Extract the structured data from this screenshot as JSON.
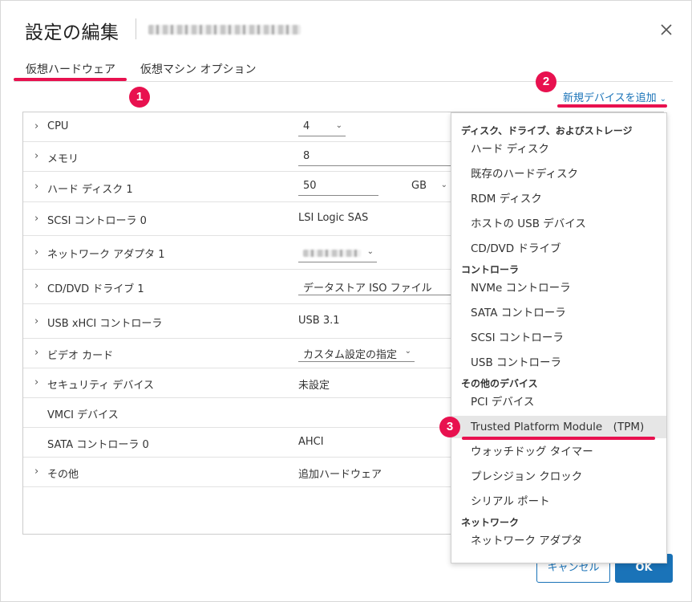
{
  "dialog": {
    "title": "設定の編集",
    "close_icon": "close-icon"
  },
  "tabs": [
    {
      "label": "仮想ハードウェア"
    },
    {
      "label": "仮想マシン オプション"
    }
  ],
  "markers": [
    "1",
    "2",
    "3"
  ],
  "add_device": {
    "label": "新規デバイスを追加",
    "icon": "chevron-down-icon"
  },
  "hardware": {
    "cpu": {
      "label": "CPU",
      "value": "4"
    },
    "memory": {
      "label": "メモリ",
      "value": "8"
    },
    "disk": {
      "label": "ハード ディスク 1",
      "value": "50",
      "unit": "GB"
    },
    "scsi": {
      "label": "SCSI コントローラ 0",
      "value": "LSI Logic SAS"
    },
    "network": {
      "label": "ネットワーク アダプタ 1"
    },
    "cdrom": {
      "label": "CD/DVD ドライブ 1",
      "value": "データストア ISO ファイル"
    },
    "usb": {
      "label": "USB xHCI コントローラ",
      "value": "USB 3.1"
    },
    "video": {
      "label": "ビデオ カード",
      "value": "カスタム設定の指定"
    },
    "security": {
      "label": "セキュリティ デバイス",
      "value": "未設定"
    },
    "vmci": {
      "label": "VMCI デバイス"
    },
    "sata": {
      "label": "SATA コントローラ 0",
      "value": "AHCI"
    },
    "other": {
      "label": "その他",
      "value": "追加ハードウェア"
    }
  },
  "menu": {
    "group_storage": "ディスク、ドライブ、およびストレージ",
    "hard_disk": "ハード ディスク",
    "existing_disk": "既存のハードディスク",
    "rdm_disk": "RDM ディスク",
    "host_usb": "ホストの USB デバイス",
    "cd_dvd": "CD/DVD ドライブ",
    "group_controllers": "コントローラ",
    "nvme": "NVMe コントローラ",
    "sata": "SATA コントローラ",
    "scsi": "SCSI コントローラ",
    "usb": "USB コントローラ",
    "group_other": "その他のデバイス",
    "pci": "PCI デバイス",
    "tpm": "Trusted Platform Module　(TPM)",
    "watchdog": "ウォッチドッグ タイマー",
    "precision_clock": "プレシジョン クロック",
    "serial": "シリアル ポート",
    "group_network": "ネットワーク",
    "network_adapter": "ネットワーク アダプタ"
  },
  "buttons": {
    "cancel": "キャンセル",
    "ok": "OK"
  },
  "colors": {
    "accent": "#1a73b8",
    "highlight_marker": "#e8114f",
    "menu_highlight": "#e6e6e6"
  }
}
